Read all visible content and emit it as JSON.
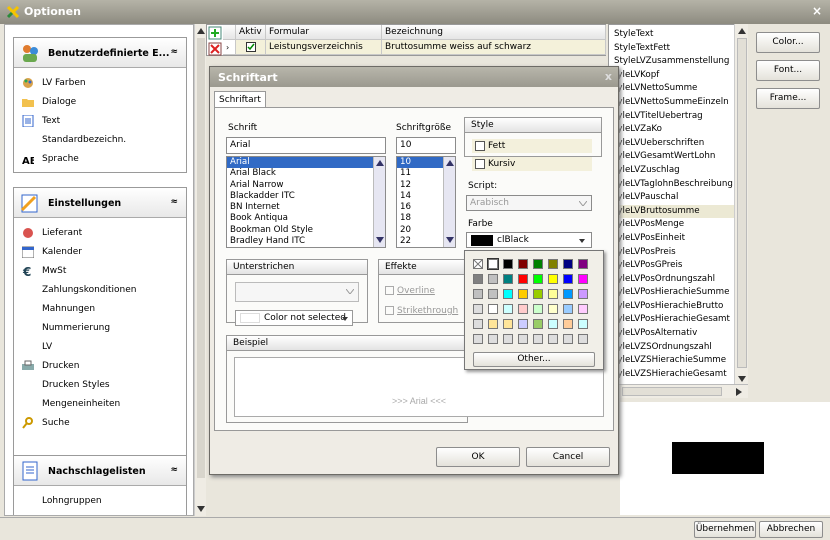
{
  "window": {
    "title": "Optionen",
    "close": "×"
  },
  "nav": {
    "groups": [
      {
        "label": "Benutzerdefinierte E...",
        "items": [
          "LV Farben",
          "Dialoge",
          "Text",
          "Standardbezeichn.",
          "Sprache"
        ]
      },
      {
        "label": "Einstellungen",
        "items": [
          "Lieferant",
          "Kalender",
          "MwSt",
          "Zahlungskonditionen",
          "Mahnungen",
          "Nummerierung",
          "LV",
          "Drucken",
          "Drucken Styles",
          "Mengeneinheiten",
          "Suche"
        ]
      },
      {
        "label": "Nachschlagelisten",
        "items": [
          "Lohngruppen"
        ]
      }
    ],
    "collapse_glyph": "≈"
  },
  "grid": {
    "headers": [
      "Aktiv",
      "Formular",
      "Bezeichnung"
    ],
    "row": {
      "formular": "Leistungsverzeichnis",
      "bezeichnung": "Bruttosumme weiss auf schwarz"
    }
  },
  "stylelist": {
    "items": [
      "StyleText",
      "StyleTextFett",
      "StyleLVZusammenstellung",
      "tyleLVKopf",
      "tyleLVNettoSumme",
      "tyleLVNettoSummeEinzeln",
      "tyleLVTitelUebertrag",
      "tyleLVZaKo",
      "tyleLVUeberschriften",
      "tyleLVGesamtWertLohn",
      "tyleLVZuschlag",
      "tyleLVTaglohnBeschreibung",
      "tyleLVPauschal",
      "tyleLVBruttosumme",
      "tyleLVPosMenge",
      "tyleLVPosEinheit",
      "tyleLVPosPreis",
      "tyleLVPosGPreis",
      "tyleLVPosOrdnungszahl",
      "tyleLVPosHierachieSumme",
      "tyleLVPosHierachieBrutto",
      "tyleLVPosHierachieGesamt",
      "tyleLVPosAlternativ",
      "tyleLVZSOrdnungszahl",
      "tyleLVZSHierachieSumme",
      "tyleLVZSHierachieGesamt"
    ],
    "selected": 13
  },
  "buttons": {
    "color": "Color...",
    "font": "Font...",
    "frame": "Frame..."
  },
  "dialog": {
    "title": "Schriftart",
    "close": "x",
    "tab": "Schriftart",
    "font_label": "Schrift",
    "font_value": "Arial",
    "fonts": [
      "Arial",
      "Arial Black",
      "Arial Narrow",
      "Blackadder ITC",
      "BN Internet",
      "Book Antiqua",
      "Bookman Old Style",
      "Bradley Hand ITC"
    ],
    "size_label": "Schriftgröße",
    "size_value": "10",
    "sizes": [
      "10",
      "11",
      "12",
      "14",
      "16",
      "18",
      "20",
      "22"
    ],
    "style_label": "Style",
    "bold": "Fett",
    "italic": "Kursiv",
    "script_label": "Script:",
    "script_value": "Arabisch",
    "color_label": "Farbe",
    "color_value": "clBlack",
    "underline_label": "Unterstrichen",
    "underline_color": "Color not selected",
    "effects_label": "Effekte",
    "overline": "Overline",
    "strike": "Strikethrough",
    "example_label": "Beispiel",
    "example_text": ">>> Arial <<<",
    "ok": "OK",
    "cancel": "Cancel",
    "other": "Other..."
  },
  "palette": {
    "colors": [
      "#ffffff",
      "#000000",
      "#800000",
      "#008000",
      "#808000",
      "#000080",
      "#800080",
      "#808080",
      "#c0c0c0",
      "#008080",
      "#ff0000",
      "#00ff00",
      "#ffff00",
      "#0000ff",
      "#ff00ff",
      "#c0c0c0",
      "#c0c0c0",
      "#00ffff",
      "#ffcc00",
      "#99cc00",
      "#ffff99",
      "#0099ff",
      "#cc99ff",
      "#dddddd",
      "#ffffff",
      "#ccffff",
      "#ffcccc",
      "#ccffcc",
      "#ffffcc",
      "#99ccff",
      "#ffccff",
      "#dddddd",
      "#ffe599",
      "#ffe599",
      "#ccccff",
      "#99cc66",
      "#ccffff",
      "#ffcc99",
      "#ccffff",
      "#dddddd",
      "#dddddd",
      "#dddddd",
      "#dddddd",
      "#dddddd",
      "#dddddd",
      "#dddddd",
      "#dddddd"
    ]
  },
  "status": {
    "apply": "Übernehmen",
    "cancel": "Abbrechen"
  }
}
